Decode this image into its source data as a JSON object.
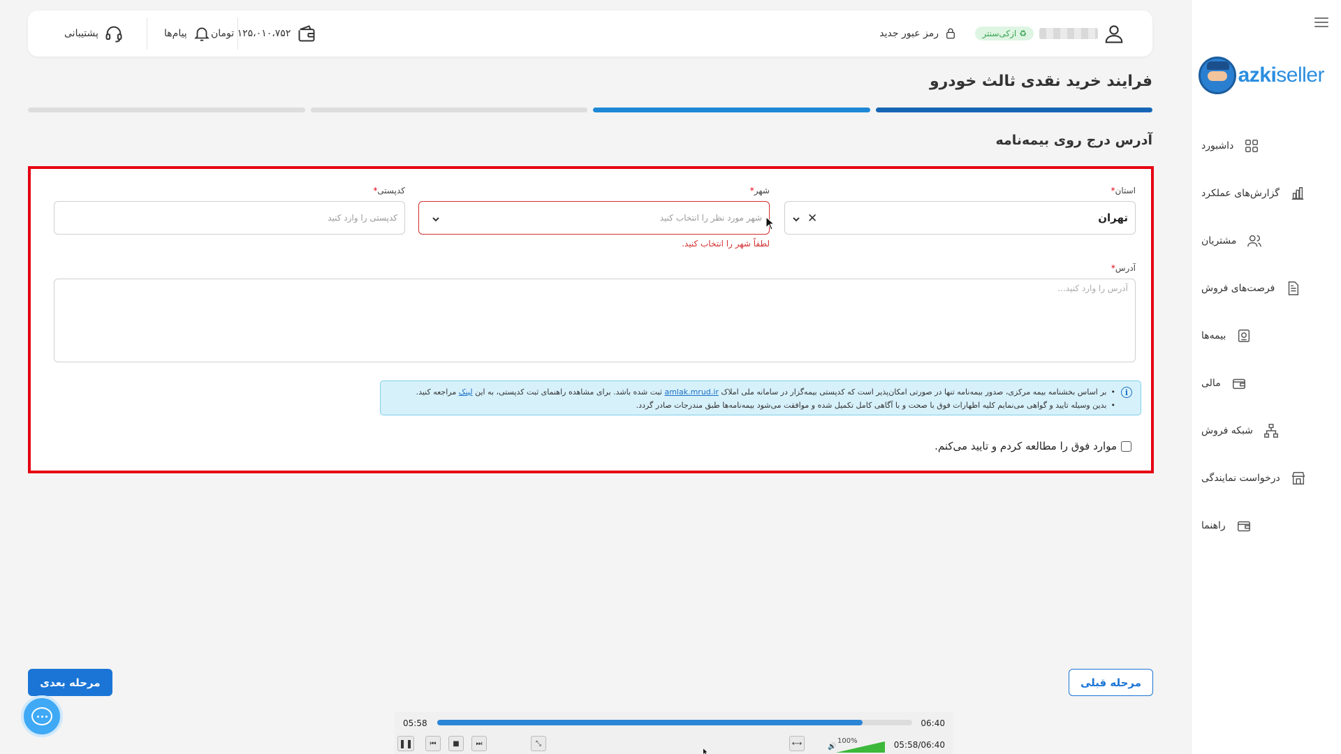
{
  "sidebar": {
    "logo_bold": "azki",
    "logo_light": "seller",
    "items": [
      {
        "label": "داشبورد",
        "icon": "dashboard-grid-icon"
      },
      {
        "label": "گزارش‌های عملکرد",
        "icon": "bar-chart-icon"
      },
      {
        "label": "مشتریان",
        "icon": "users-icon"
      },
      {
        "label": "فرصت‌های فروش",
        "icon": "document-icon"
      },
      {
        "label": "بیمه‌ها",
        "icon": "policy-icon"
      },
      {
        "label": "مالی",
        "icon": "wallet-icon"
      },
      {
        "label": "شبکه فروش",
        "icon": "network-icon"
      },
      {
        "label": "درخواست نمایندگی",
        "icon": "store-icon"
      },
      {
        "label": "راهنما",
        "icon": "guide-icon"
      }
    ]
  },
  "topbar": {
    "badge": "ازکی‌سنتر",
    "new_password": "رمز عبور جدید",
    "balance": "۱۲۵،۰۱۰،۷۵۲ تومان",
    "messages": "پیام‌ها",
    "support": "پشتیبانی"
  },
  "page": {
    "title": "فرایند خرید نقدی ثالث خودرو",
    "section_title": "آدرس درج روی بیمه‌نامه"
  },
  "form": {
    "province_label": "استان",
    "province_value": "تهران",
    "city_label": "شهر",
    "city_placeholder": "شهر مورد نظر را انتخاب کنید",
    "city_error": "لطفاً شهر را انتخاب کنید.",
    "postal_label": "کدپستی",
    "postal_placeholder": "کدپستی را وارد کنید",
    "address_label": "آدرس",
    "address_placeholder": "آدرس را وارد کنید...",
    "required_mark": "*",
    "info_line1_a": "بر اساس بخشنامه بیمه مرکزی، صدور بیمه‌نامه تنها در صورتی امکان‌پذیر است که کدپستی بیمه‌گزار در سامانه ملی املاک",
    "info_link1": "amlak.mrud.ir",
    "info_line1_b": "ثبت شده باشد. برای مشاهده راهنمای ثبت کدپستی، به این",
    "info_link2": "لینک",
    "info_line1_c": "مراجعه کنید.",
    "info_line2": "بدین وسیله تایید و گواهی می‌نمایم کلیه اظهارات فوق با صحت و با آگاهی کامل تکمیل شده و موافقت می‌شود بیمه‌نامه‌ها طبق مندرجات صادر گردد.",
    "agree_label": "موارد فوق را مطالعه کردم و تایید می‌کنم."
  },
  "buttons": {
    "next": "مرحله بعدی",
    "prev": "مرحله قبلی"
  },
  "progress": {
    "steps_total": 4,
    "steps_completed": 2
  },
  "player": {
    "current": "05:58",
    "total": "06:40",
    "progress_fraction": 0.896,
    "volume": "100%",
    "time_display": "05:58/06:40"
  },
  "colors": {
    "accent": "#1a75d6",
    "error": "#d32f2f",
    "highlight_border": "#e60012",
    "badge_green": "#37a551"
  }
}
